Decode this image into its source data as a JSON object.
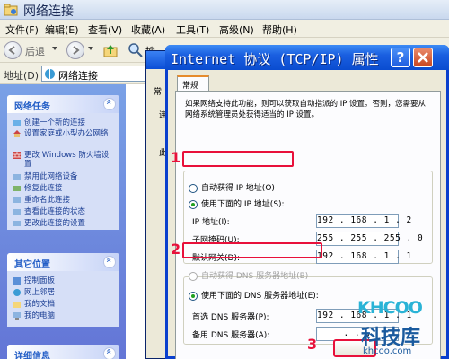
{
  "explorer": {
    "title": "网络连接",
    "menu": [
      "文件(F)",
      "编辑(E)",
      "查看(V)",
      "收藏(A)",
      "工具(T)",
      "高级(N)",
      "帮助(H)"
    ],
    "toolbar": {
      "back": "后退",
      "search_partial": "搜"
    },
    "address": {
      "label": "地址(D)",
      "value": "网络连接"
    }
  },
  "sidebar": {
    "network_tasks": {
      "title": "网络任务",
      "items": [
        "创建一个新的连接",
        "设置家庭或小型办公网络",
        "更改 Windows 防火墙设置",
        "禁用此网络设备",
        "修复此连接",
        "重命名此连接",
        "查看此连接的状态",
        "更改此连接的设置"
      ]
    },
    "other_places": {
      "title": "其它位置",
      "items": [
        "控制面板",
        "网上邻居",
        "我的文档",
        "我的电脑"
      ]
    },
    "details": {
      "title": "详细信息"
    }
  },
  "behind": {
    "tab": "常",
    "text_a": "连",
    "text_b": "此",
    "text_c": "常"
  },
  "dialog": {
    "title": "Internet 协议 (TCP/IP) 属性",
    "help": "?",
    "tab_general": "常规",
    "description": "如果网络支持此功能，则可以获取自动指派的 IP 设置。否则，您需要从网络系统管理员处获得适当的 IP 设置。",
    "ip_auto": "自动获得 IP 地址(O)",
    "ip_manual": "使用下面的 IP 地址(S):",
    "ip_address_label": "IP 地址(I):",
    "ip_address": "192 . 168 .   1 .   2",
    "subnet_label": "子网掩码(U):",
    "subnet": "255 . 255 . 255 .   0",
    "gateway_label": "默认网关(D):",
    "gateway": "192 . 168 .   1 .   1",
    "dns_auto": "自动获得 DNS 服务器地址(B)",
    "dns_manual": "使用下面的 DNS 服务器地址(E):",
    "dns_primary_label": "首选 DNS 服务器(P):",
    "dns_primary": "192 . 168 .   1 .   1",
    "dns_alt_label": "备用 DNS 服务器(A):",
    "dns_alt": "   .     .     .   "
  },
  "annotations": {
    "step1": "1",
    "step2": "2",
    "step3": "3"
  },
  "watermark": {
    "brand": "KHCOO",
    "cn": "科技库",
    "url": "khcoo.com"
  },
  "colors": {
    "highlight": "#e8103a",
    "title_blue": "#0a4cd0",
    "link_blue": "#1c3f94"
  }
}
